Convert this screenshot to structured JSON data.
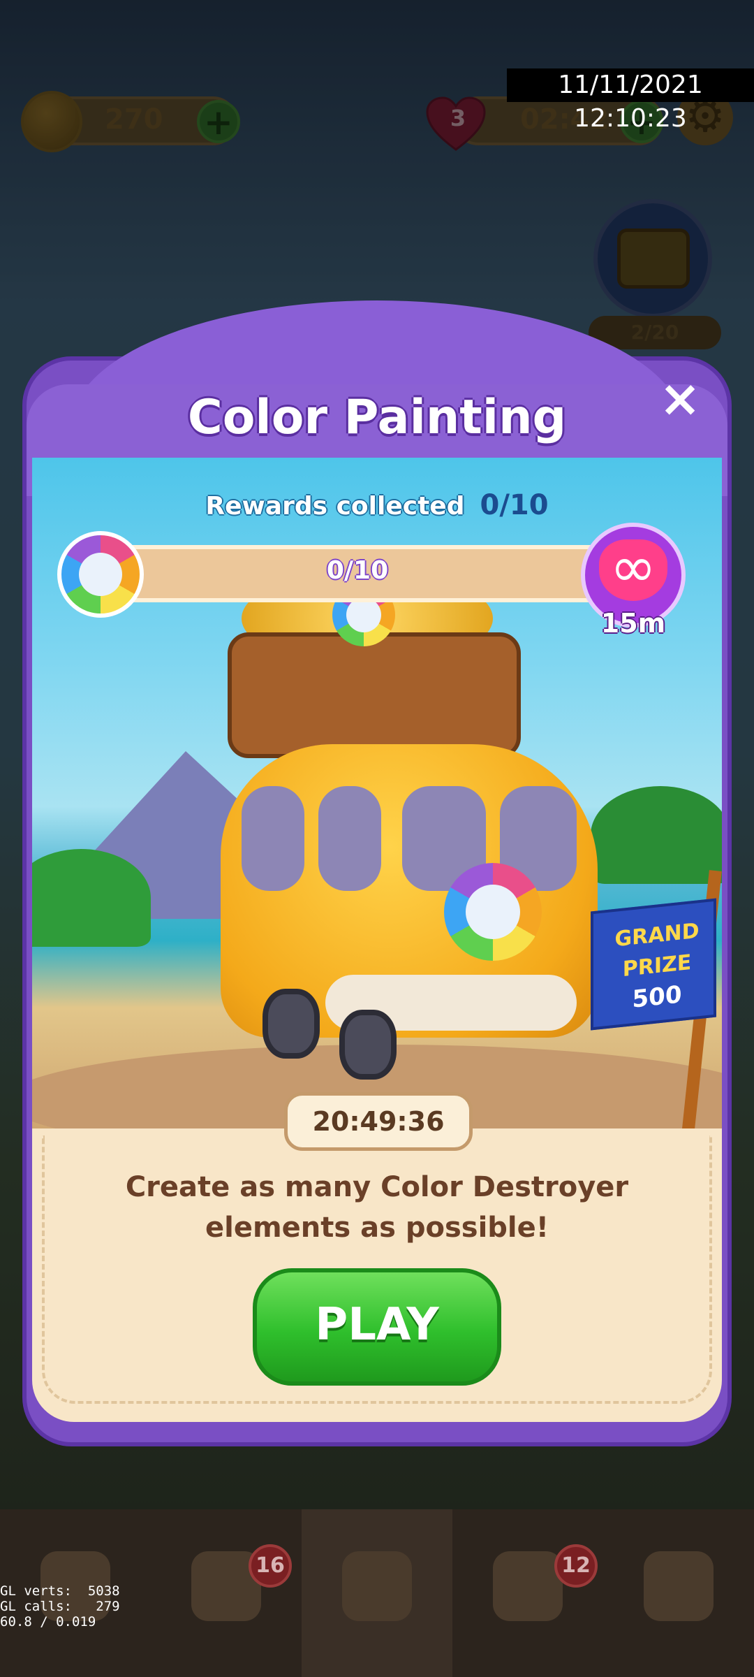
{
  "status_overlay": {
    "timestamp": "11/11/2021 12:10:23"
  },
  "hud": {
    "coins": "270",
    "lives": "3",
    "life_timer": "02:42",
    "event_progress": "2/20",
    "icons": [
      "coin-icon",
      "plus-icon",
      "heart-icon",
      "gear-icon",
      "chest-icon"
    ]
  },
  "modal": {
    "title": "Color Painting",
    "close_label": "×",
    "rewards_label": "Rewards collected",
    "rewards_value": "0/10",
    "progress_text": "0/10",
    "progress_fraction": 0,
    "infinite_lives_time": "15m",
    "infinite_symbol": "∞",
    "grand_prize": {
      "line1": "GRAND",
      "line2": "PRIZE",
      "amount": "500"
    },
    "timer": "20:49:36",
    "description": "Create as many Color Destroyer elements as possible!",
    "play_label": "PLAY"
  },
  "bottom_nav": {
    "items": [
      {
        "name": "cards",
        "icon": "cards-icon",
        "badge": ""
      },
      {
        "name": "inbox",
        "icon": "heart-mail-icon",
        "badge": "16"
      },
      {
        "name": "home",
        "icon": "home-icon",
        "badge": ""
      },
      {
        "name": "team",
        "icon": "team-icon",
        "badge": "12"
      },
      {
        "name": "leaderboard",
        "icon": "trophy-icon",
        "badge": ""
      }
    ]
  },
  "debug": {
    "line1": "GL verts:  5038",
    "line2": "GL calls:   279",
    "line3": "60.8 / 0.019"
  },
  "colors": {
    "modal_purple": "#7a4fc4",
    "play_green": "#2fbf2c",
    "infinite_pink": "#ff3f8a"
  }
}
